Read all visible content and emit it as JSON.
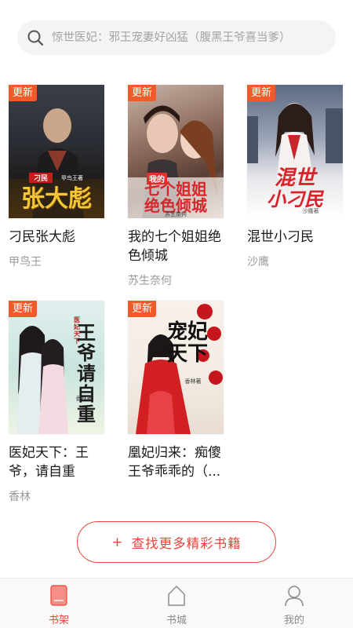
{
  "search": {
    "placeholder": "惊世医妃：邪王宠妻好凶猛（腹黑王爷喜当爹）"
  },
  "books": [
    {
      "title": "刁民张大彪",
      "author": "甲鸟王",
      "badge": "更新",
      "cover_text": "张大彪",
      "cover_tag": "刁民",
      "cover_author": "甲鸟王著"
    },
    {
      "title": "我的七个姐姐绝色倾城",
      "author": "苏生奈何",
      "badge": "更新",
      "cover_text_line1": "七个姐姐",
      "cover_text_line2": "绝色倾城",
      "cover_tag": "我的",
      "cover_author": "苏生奈何"
    },
    {
      "title": "混世小刁民",
      "author": "沙鹰",
      "badge": "更新",
      "cover_text_line1": "混世",
      "cover_text_line2": "小刁民",
      "cover_author": "沙鹰著"
    },
    {
      "title": "医妃天下：王爷，请自重",
      "author": "香林",
      "badge": "更新",
      "cover_text": "王爷请自重",
      "cover_tag": "医妃天下",
      "cover_author": "香林著"
    },
    {
      "title": "凰妃归来：痴傻王爷乖乖的（...",
      "author": "",
      "badge": "更新",
      "cover_text": "宠妃天下",
      "cover_author": "香林著"
    }
  ],
  "more_button": {
    "plus": "+",
    "label": "查找更多精彩书籍"
  },
  "tabs": [
    {
      "label": "书架",
      "icon": "bookshelf-icon",
      "active": true
    },
    {
      "label": "书城",
      "icon": "bookstore-icon",
      "active": false
    },
    {
      "label": "我的",
      "icon": "profile-icon",
      "active": false
    }
  ],
  "colors": {
    "accent": "#e8453c",
    "badge": "#f15b2a",
    "muted_text": "#999999",
    "tab_inactive": "#8a8a8a"
  }
}
